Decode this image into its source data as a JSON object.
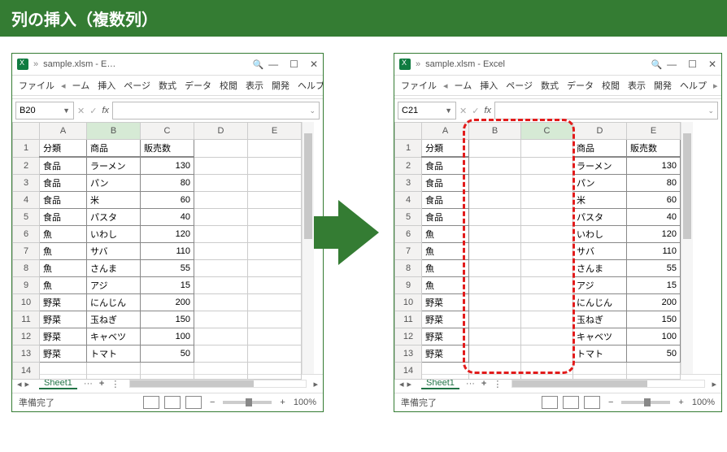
{
  "page_title": "列の挿入（複数列）",
  "arrow_label": "insert-columns-arrow",
  "left": {
    "window_title": "sample.xlsm  -  E…",
    "ribbon_tabs": [
      "ファイル",
      "ーム",
      "挿入",
      "ページ",
      "数式",
      "データ",
      "校閲",
      "表示",
      "開発",
      "ヘルプ"
    ],
    "name_box": "B20",
    "col_headers": [
      "A",
      "B",
      "C",
      "D",
      "E"
    ],
    "selected_col": "B",
    "rows": [
      [
        "分類",
        "商品",
        "販売数",
        "",
        ""
      ],
      [
        "食品",
        "ラーメン",
        "130",
        "",
        ""
      ],
      [
        "食品",
        "パン",
        "80",
        "",
        ""
      ],
      [
        "食品",
        "米",
        "60",
        "",
        ""
      ],
      [
        "食品",
        "パスタ",
        "40",
        "",
        ""
      ],
      [
        "魚",
        "いわし",
        "120",
        "",
        ""
      ],
      [
        "魚",
        "サバ",
        "110",
        "",
        ""
      ],
      [
        "魚",
        "さんま",
        "55",
        "",
        ""
      ],
      [
        "魚",
        "アジ",
        "15",
        "",
        ""
      ],
      [
        "野菜",
        "にんじん",
        "200",
        "",
        ""
      ],
      [
        "野菜",
        "玉ねぎ",
        "150",
        "",
        ""
      ],
      [
        "野菜",
        "キャベツ",
        "100",
        "",
        ""
      ],
      [
        "野菜",
        "トマト",
        "50",
        "",
        ""
      ],
      [
        "",
        "",
        "",
        "",
        ""
      ]
    ],
    "sheet_name": "Sheet1",
    "status": "準備完了",
    "zoom": "100%"
  },
  "right": {
    "window_title": "sample.xlsm  -  Excel",
    "ribbon_tabs": [
      "ファイル",
      "ーム",
      "挿入",
      "ページ",
      "数式",
      "データ",
      "校閲",
      "表示",
      "開発",
      "ヘルプ"
    ],
    "name_box": "C21",
    "col_headers": [
      "A",
      "B",
      "C",
      "D",
      "E"
    ],
    "selected_col": "C",
    "rows": [
      [
        "分類",
        "",
        "",
        "商品",
        "販売数"
      ],
      [
        "食品",
        "",
        "",
        "ラーメン",
        "130"
      ],
      [
        "食品",
        "",
        "",
        "パン",
        "80"
      ],
      [
        "食品",
        "",
        "",
        "米",
        "60"
      ],
      [
        "食品",
        "",
        "",
        "パスタ",
        "40"
      ],
      [
        "魚",
        "",
        "",
        "いわし",
        "120"
      ],
      [
        "魚",
        "",
        "",
        "サバ",
        "110"
      ],
      [
        "魚",
        "",
        "",
        "さんま",
        "55"
      ],
      [
        "魚",
        "",
        "",
        "アジ",
        "15"
      ],
      [
        "野菜",
        "",
        "",
        "にんじん",
        "200"
      ],
      [
        "野菜",
        "",
        "",
        "玉ねぎ",
        "150"
      ],
      [
        "野菜",
        "",
        "",
        "キャベツ",
        "100"
      ],
      [
        "野菜",
        "",
        "",
        "トマト",
        "50"
      ],
      [
        "",
        "",
        "",
        "",
        ""
      ]
    ],
    "sheet_name": "Sheet1",
    "status": "準備完了",
    "zoom": "100%"
  }
}
